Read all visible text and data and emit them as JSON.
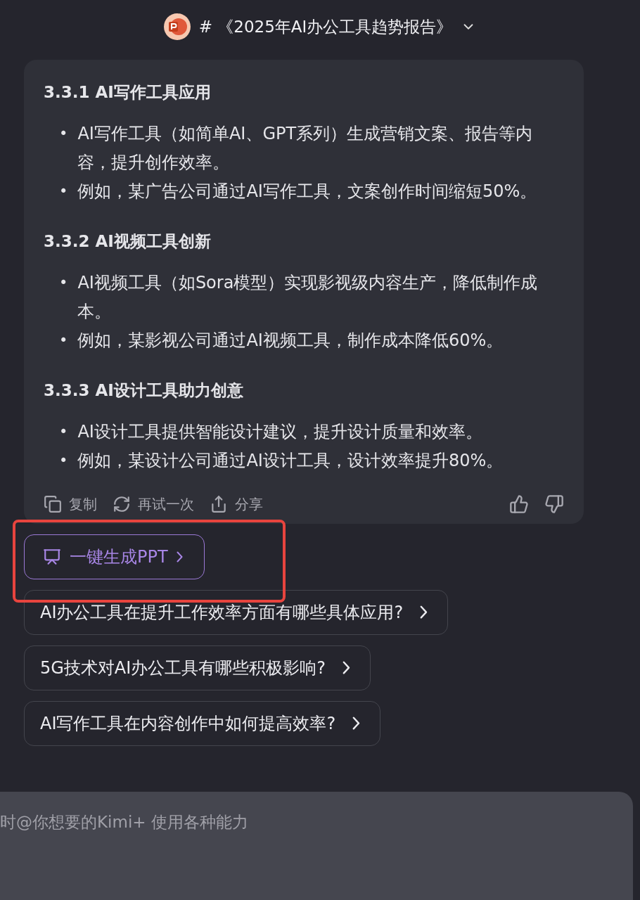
{
  "header": {
    "title": "# 《2025年AI办公工具趋势报告》"
  },
  "bullet_marker": "•",
  "sections": [
    {
      "heading": "3.3.1 AI写作工具应用",
      "bullets": [
        "AI写作工具（如简单AI、GPT系列）生成营销文案、报告等内容，提升创作效率。",
        "例如，某广告公司通过AI写作工具，文案创作时间缩短50%。"
      ]
    },
    {
      "heading": "3.3.2 AI视频工具创新",
      "bullets": [
        "AI视频工具（如Sora模型）实现影视级内容生产，降低制作成本。",
        "例如，某影视公司通过AI视频工具，制作成本降低60%。"
      ]
    },
    {
      "heading": "3.3.3 AI设计工具助力创意",
      "bullets": [
        "AI设计工具提供智能设计建议，提升设计质量和效率。",
        "例如，某设计公司通过AI设计工具，设计效率提升80%。"
      ]
    }
  ],
  "actions": [
    {
      "kind": "copy",
      "label": "复制"
    },
    {
      "kind": "retry",
      "label": "再试一次"
    },
    {
      "kind": "share",
      "label": "分享"
    }
  ],
  "ppt_button": {
    "label": "一键生成PPT",
    "highlighted": true
  },
  "suggestions": [
    "AI办公工具在提升工作效率方面有哪些具体应用?",
    "5G技术对AI办公工具有哪些积极影响?",
    "AI写作工具在内容创作中如何提高效率?"
  ],
  "input": {
    "placeholder": "时@你想要的Kimi+ 使用各种能力"
  }
}
